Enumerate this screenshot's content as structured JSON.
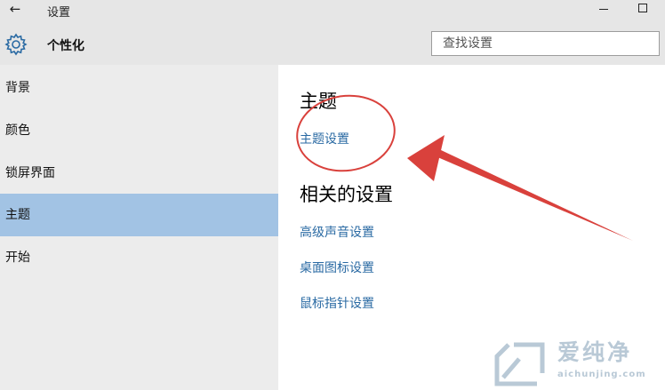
{
  "titlebar": {
    "back_icon": "back-arrow-icon",
    "title": "设置",
    "minimize_icon": "minimize-icon",
    "maximize_icon": "maximize-icon"
  },
  "header": {
    "icon": "gear-icon",
    "title": "个性化",
    "search_placeholder": "查找设置"
  },
  "sidebar": {
    "items": [
      {
        "label": "背景"
      },
      {
        "label": "颜色"
      },
      {
        "label": "锁屏界面"
      },
      {
        "label": "主题",
        "selected": true
      },
      {
        "label": "开始"
      }
    ]
  },
  "main": {
    "theme_heading": "主题",
    "theme_settings_link": "主题设置",
    "related_heading": "相关的设置",
    "related_links": [
      "高级声音设置",
      "桌面图标设置",
      "鼠标指针设置"
    ]
  },
  "watermark": {
    "text": "爱纯净",
    "url": "aichunjing.com"
  },
  "colors": {
    "accent_link": "#2a6aa3",
    "selected_item": "#a2c3e4",
    "annotation": "#d9413c"
  }
}
